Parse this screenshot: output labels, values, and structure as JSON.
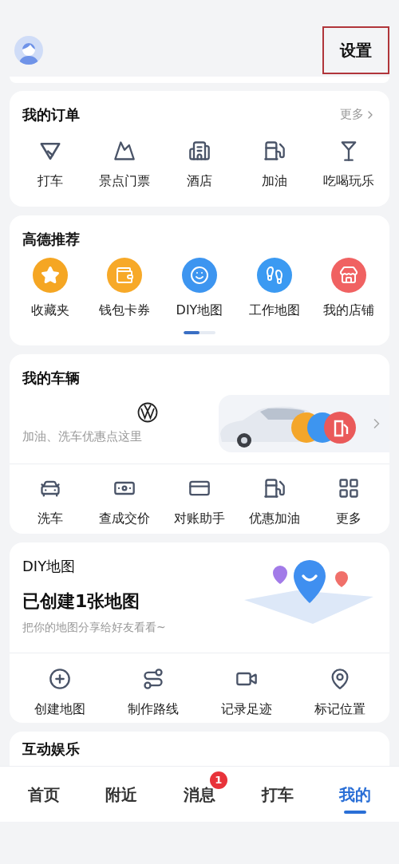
{
  "header": {
    "settings_label": "设置",
    "settings_highlighted": true
  },
  "orders": {
    "title": "我的订单",
    "more": "更多",
    "items": [
      "打车",
      "景点门票",
      "酒店",
      "加油",
      "吃喝玩乐"
    ]
  },
  "recommend": {
    "title": "高德推荐",
    "items": [
      {
        "label": "收藏夹",
        "color": "#f5a623"
      },
      {
        "label": "钱包卡券",
        "color": "#f7a928"
      },
      {
        "label": "DIY地图",
        "color": "#3d95f0"
      },
      {
        "label": "工作地图",
        "color": "#3b9af2"
      },
      {
        "label": "我的店铺",
        "color": "#f06262"
      }
    ],
    "pages": [
      {
        "selected": true
      },
      {
        "selected": false
      }
    ]
  },
  "vehicle": {
    "title": "我的车辆",
    "hint": "加油、洗车优惠点这里",
    "services": [
      "洗车",
      "查成交价",
      "对账助手",
      "优惠加油",
      "更多"
    ]
  },
  "diy_map": {
    "title": "DIY地图",
    "headline": "已创建1张地图",
    "subtitle": "把你的地图分享给好友看看~",
    "actions": [
      "创建地图",
      "制作路线",
      "记录足迹",
      "标记位置"
    ]
  },
  "next_section": {
    "title": "互动娱乐"
  },
  "tabs": [
    {
      "label": "首页",
      "selected": false
    },
    {
      "label": "附近",
      "selected": false
    },
    {
      "label": "消息",
      "selected": false,
      "badge": "1"
    },
    {
      "label": "打车",
      "selected": false
    },
    {
      "label": "我的",
      "selected": true
    }
  ]
}
